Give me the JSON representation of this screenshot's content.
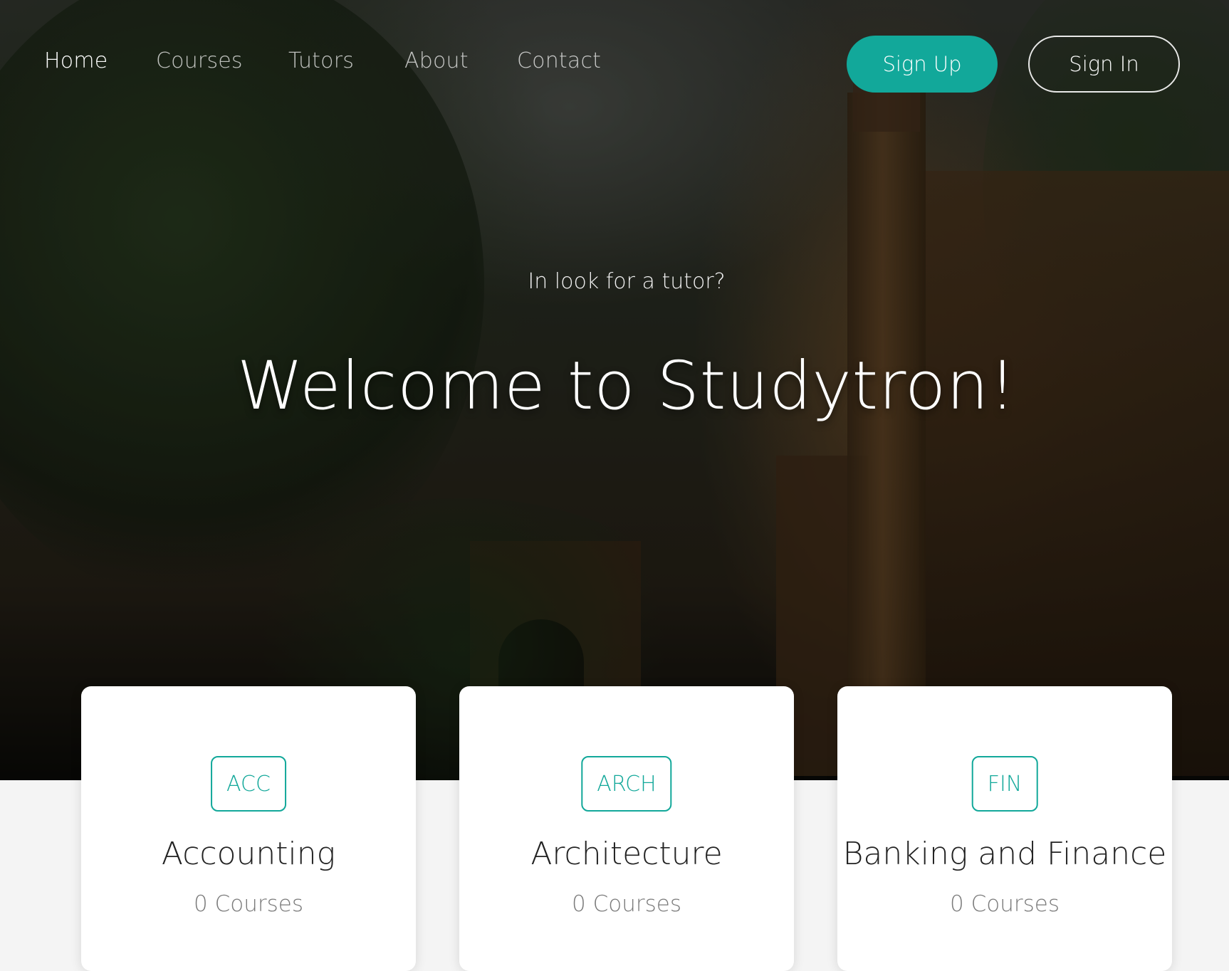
{
  "nav": {
    "items": [
      {
        "label": "Home",
        "active": true
      },
      {
        "label": "Courses",
        "active": false
      },
      {
        "label": "Tutors",
        "active": false
      },
      {
        "label": "About",
        "active": false
      },
      {
        "label": "Contact",
        "active": false
      }
    ],
    "signup_label": "Sign Up",
    "signin_label": "Sign In"
  },
  "hero": {
    "subtitle": "In look for a tutor?",
    "title": "Welcome to Studytron!"
  },
  "categories": [
    {
      "code": "ACC",
      "name": "Accounting",
      "count": "0 Courses"
    },
    {
      "code": "ARCH",
      "name": "Architecture",
      "count": "0 Courses"
    },
    {
      "code": "FIN",
      "name": "Banking and Finance",
      "count": "0 Courses"
    }
  ],
  "colors": {
    "accent": "#12a89a",
    "card_bg": "#ffffff",
    "page_bg": "#f4f4f4"
  }
}
